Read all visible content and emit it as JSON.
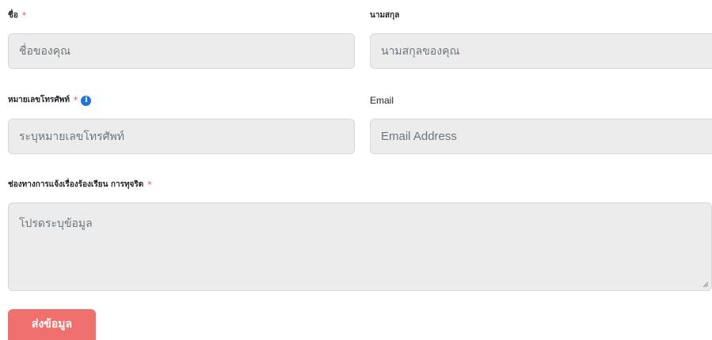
{
  "form": {
    "first_name": {
      "label": "ชื่อ",
      "required_mark": "*",
      "placeholder": "ชื่อของคุณ"
    },
    "last_name": {
      "label": "นามสกุล",
      "placeholder": "นามสกุลของคุณ"
    },
    "phone": {
      "label": "หมายเลขโทรศัพท์",
      "required_mark": "*",
      "info_icon_glyph": "i",
      "placeholder": "ระบุหมายเลขโทรศัพท์"
    },
    "email": {
      "label": "Email",
      "placeholder": "Email Address"
    },
    "channel": {
      "label": "ช่องทางการแจ้งเรื่องร้องเรียน การทุจริต",
      "required_mark": "*",
      "placeholder": "โปรดระบุข้อมูล"
    },
    "submit_label": "ส่งข้อมูล"
  },
  "colors": {
    "required": "#e8514f",
    "info_icon": "#1f73d8",
    "submit_button": "#f0706e",
    "field_background": "#ececec"
  },
  "icons": {
    "info": "info-icon",
    "resize": "resize-handle-icon"
  }
}
